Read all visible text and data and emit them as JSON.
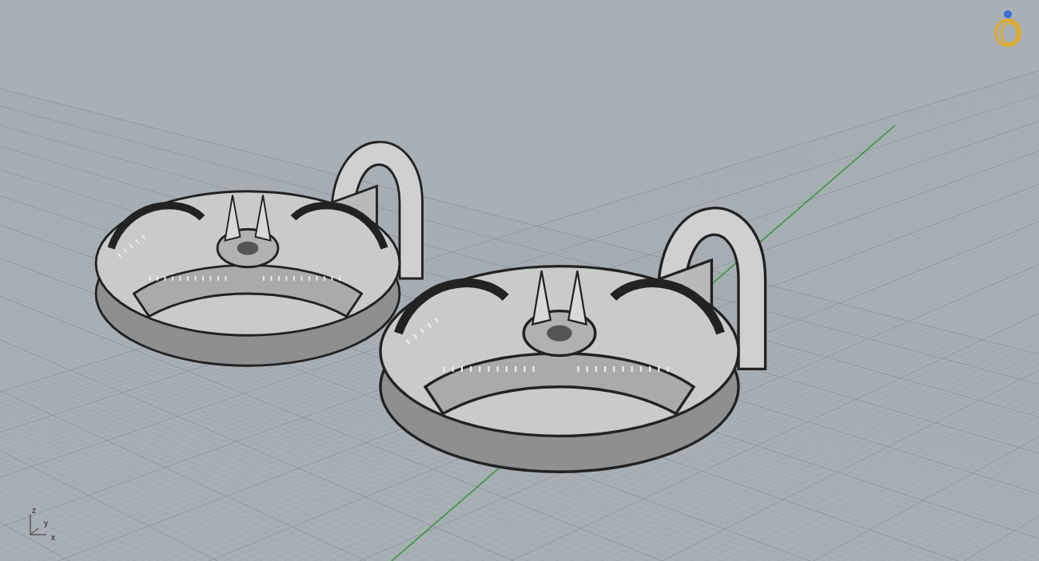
{
  "viewport": {
    "axes": [
      {
        "label": "z"
      },
      {
        "label": "y"
      },
      {
        "label": "x"
      }
    ]
  }
}
